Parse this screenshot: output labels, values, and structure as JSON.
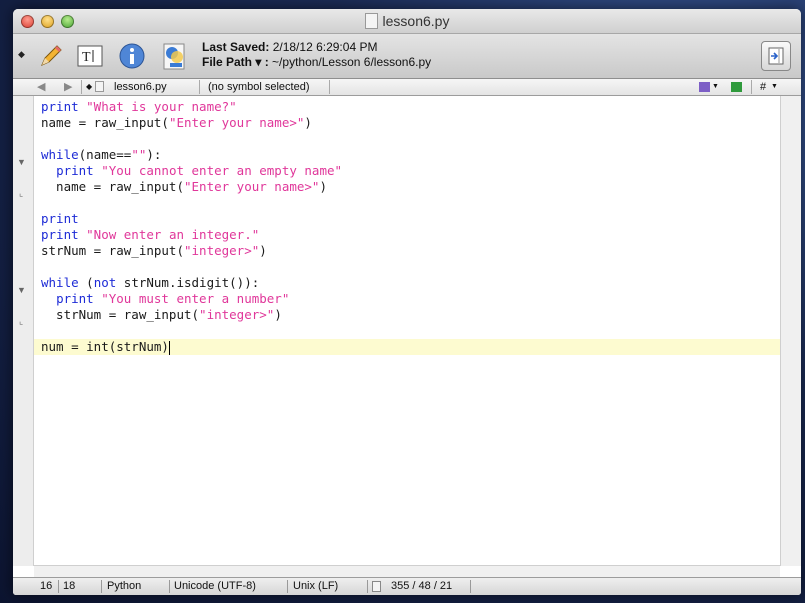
{
  "window": {
    "title": "lesson6.py"
  },
  "toolbar": {
    "last_saved_label": "Last Saved:",
    "last_saved_value": "2/18/12 6:29:04 PM",
    "file_path_label": "File Path ▾ :",
    "file_path_value": "~/python/Lesson 6/lesson6.py"
  },
  "navbar": {
    "back": "◀",
    "forward": "▶",
    "file_name": "lesson6.py",
    "symbol": "(no symbol selected)",
    "hash": "#"
  },
  "code": [
    [
      {
        "t": "print ",
        "c": "kw"
      },
      {
        "t": "\"What is your name?\"",
        "c": "str"
      }
    ],
    [
      {
        "t": "name = raw_input(",
        "c": ""
      },
      {
        "t": "\"Enter your name>\"",
        "c": "str"
      },
      {
        "t": ")",
        "c": ""
      }
    ],
    [],
    [
      {
        "t": "while",
        "c": "kw"
      },
      {
        "t": "(name==",
        "c": ""
      },
      {
        "t": "\"\"",
        "c": "str"
      },
      {
        "t": "):",
        "c": ""
      }
    ],
    [
      {
        "t": "  ",
        "c": ""
      },
      {
        "t": "print ",
        "c": "kw"
      },
      {
        "t": "\"You cannot enter an empty name\"",
        "c": "str"
      }
    ],
    [
      {
        "t": "  name = raw_input(",
        "c": ""
      },
      {
        "t": "\"Enter your name>\"",
        "c": "str"
      },
      {
        "t": ")",
        "c": ""
      }
    ],
    [],
    [
      {
        "t": "print",
        "c": "kw"
      }
    ],
    [
      {
        "t": "print ",
        "c": "kw"
      },
      {
        "t": "\"Now enter an integer.\"",
        "c": "str"
      }
    ],
    [
      {
        "t": "strNum = raw_input(",
        "c": ""
      },
      {
        "t": "\"integer>\"",
        "c": "str"
      },
      {
        "t": ")",
        "c": ""
      }
    ],
    [],
    [
      {
        "t": "while ",
        "c": "kw"
      },
      {
        "t": "(",
        "c": ""
      },
      {
        "t": "not ",
        "c": "kw"
      },
      {
        "t": "strNum.isdigit()):",
        "c": ""
      }
    ],
    [
      {
        "t": "  ",
        "c": ""
      },
      {
        "t": "print ",
        "c": "kw"
      },
      {
        "t": "\"You must enter a number\"",
        "c": "str"
      }
    ],
    [
      {
        "t": "  strNum = raw_input(",
        "c": ""
      },
      {
        "t": "\"integer>\"",
        "c": "str"
      },
      {
        "t": ")",
        "c": ""
      }
    ],
    [],
    [
      {
        "t": "num = int(strNum)",
        "c": ""
      }
    ]
  ],
  "status": {
    "line": "16",
    "column": "18",
    "language": "Python",
    "encoding": "Unicode (UTF-8)",
    "line_endings": "Unix (LF)",
    "counts": "355 / 48 / 21"
  },
  "colors": {
    "keyword": "#1d2bd6",
    "string": "#e0379a",
    "current_line": "#fdfbd0"
  }
}
